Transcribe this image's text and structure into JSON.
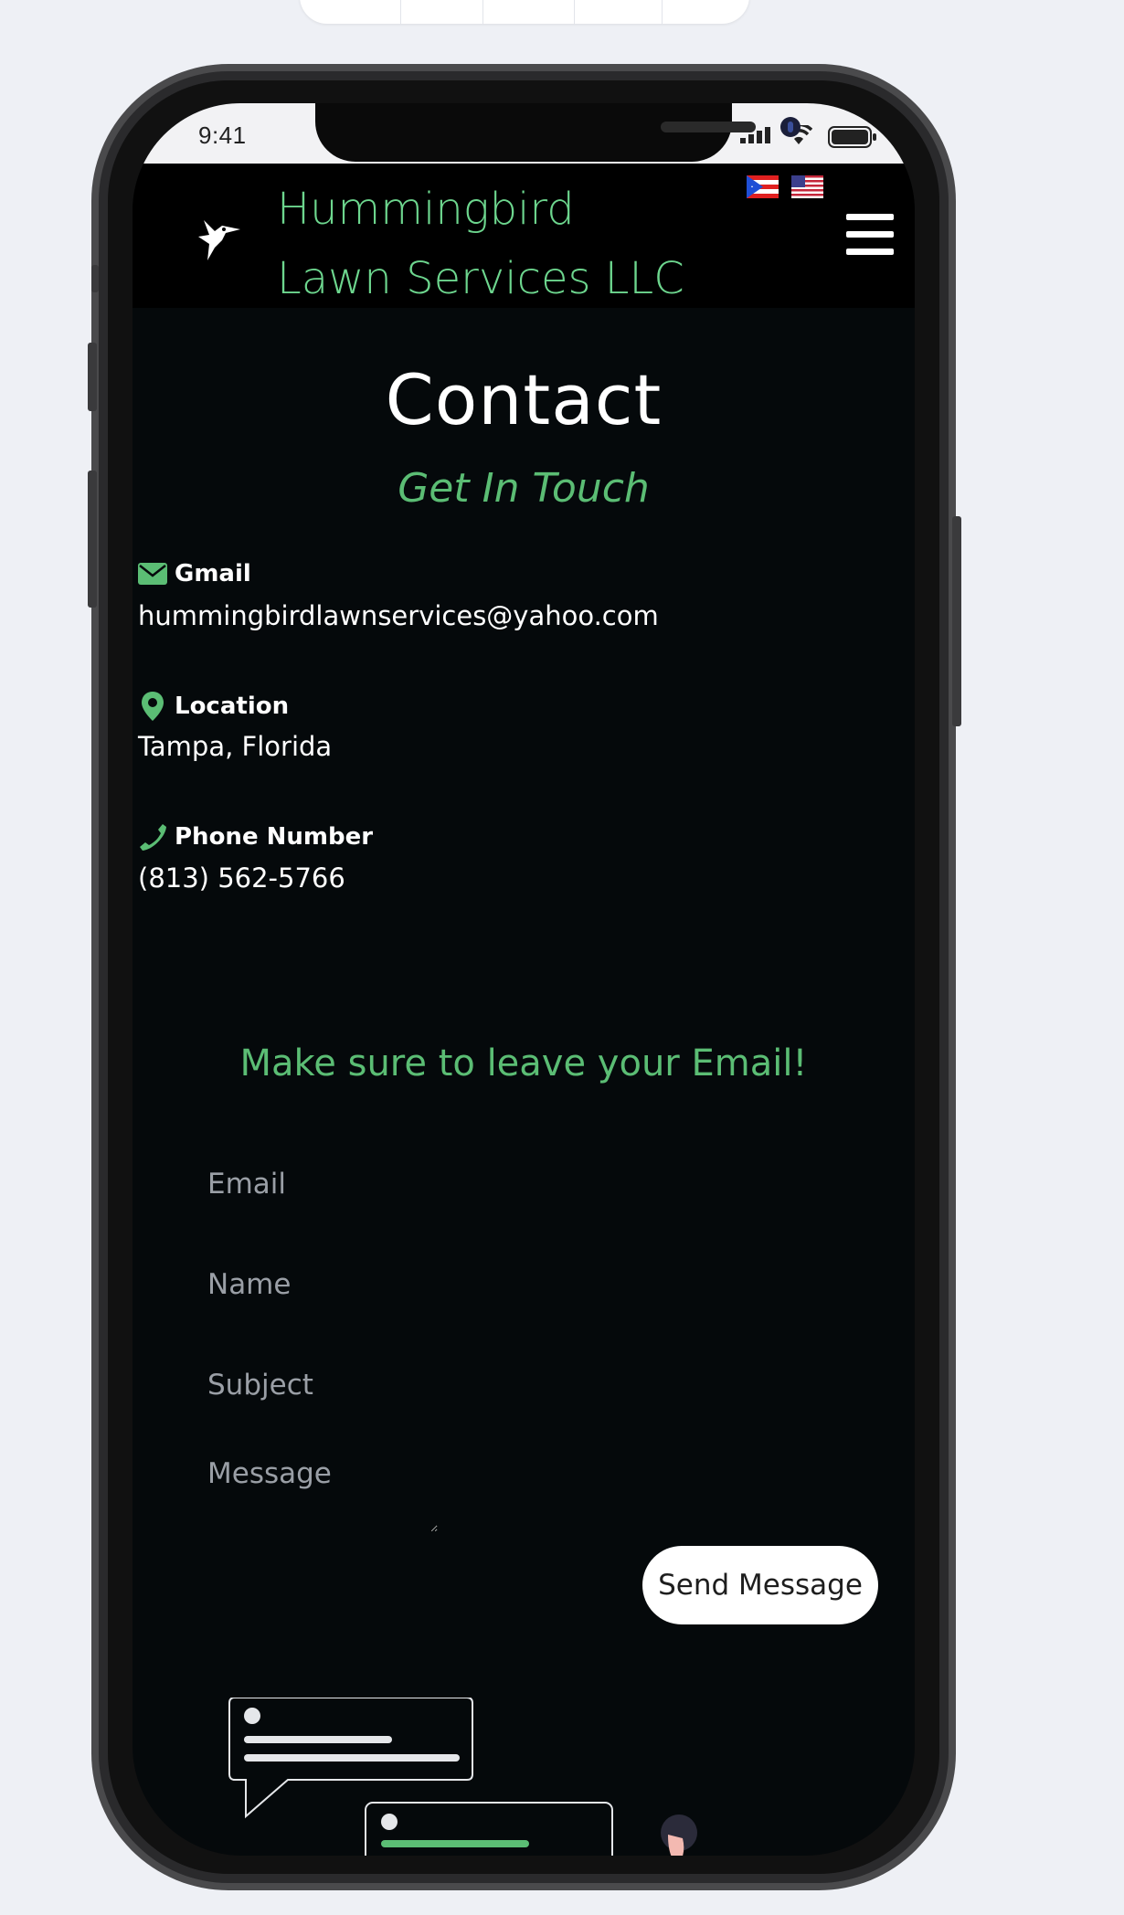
{
  "status_bar": {
    "time": "9:41"
  },
  "nav": {
    "brand_line1": "Hummingbird",
    "brand_line2": "Lawn Services LLC"
  },
  "page": {
    "title": "Contact",
    "subtitle": "Get In Touch"
  },
  "contact_info": [
    {
      "label": "Gmail",
      "value": "hummingbirdlawnservices@yahoo.com",
      "icon": "envelope-icon"
    },
    {
      "label": "Location",
      "value": "Tampa, Florida",
      "icon": "map-pin-icon"
    },
    {
      "label": "Phone Number",
      "value": "(813) 562-5766",
      "icon": "phone-icon"
    }
  ],
  "form": {
    "heading": "Make sure to leave your Email!",
    "email_placeholder": "Email",
    "name_placeholder": "Name",
    "subject_placeholder": "Subject",
    "message_placeholder": "Message",
    "submit_label": "Send Message"
  },
  "colors": {
    "accent_green": "#5bbd74",
    "brand_green": "#6dd68e",
    "background": "#05090b"
  }
}
